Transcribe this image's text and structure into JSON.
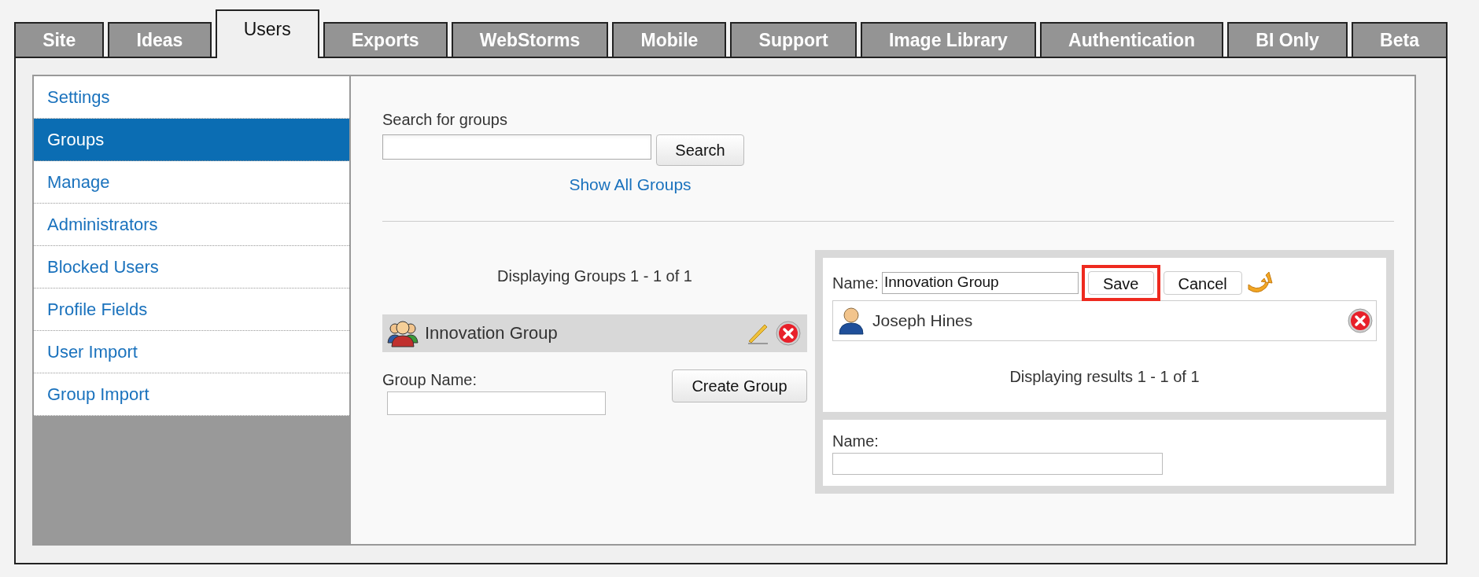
{
  "tabs": [
    {
      "label": "Site",
      "selected": false
    },
    {
      "label": "Ideas",
      "selected": false
    },
    {
      "label": "Users",
      "selected": true
    },
    {
      "label": "Exports",
      "selected": false
    },
    {
      "label": "WebStorms",
      "selected": false
    },
    {
      "label": "Mobile",
      "selected": false
    },
    {
      "label": "Support",
      "selected": false
    },
    {
      "label": "Image Library",
      "selected": false
    },
    {
      "label": "Authentication",
      "selected": false
    },
    {
      "label": "BI Only",
      "selected": false
    },
    {
      "label": "Beta",
      "selected": false
    }
  ],
  "sidebar": {
    "items": [
      {
        "label": "Settings",
        "selected": false
      },
      {
        "label": "Groups",
        "selected": true
      },
      {
        "label": "Manage",
        "selected": false
      },
      {
        "label": "Administrators",
        "selected": false
      },
      {
        "label": "Blocked Users",
        "selected": false
      },
      {
        "label": "Profile Fields",
        "selected": false
      },
      {
        "label": "User Import",
        "selected": false
      },
      {
        "label": "Group Import",
        "selected": false
      }
    ]
  },
  "search": {
    "label": "Search for groups",
    "button": "Search",
    "link": "Show All Groups"
  },
  "groups_list": {
    "summary": "Displaying Groups 1 - 1 of 1",
    "rows": [
      {
        "name": "Innovation Group"
      }
    ]
  },
  "create_group": {
    "label": "Group Name:",
    "button": "Create Group"
  },
  "edit_group": {
    "label": "Name:",
    "value": "Innovation Group",
    "buttons": [
      {
        "label": "Save",
        "highlighted": true
      },
      {
        "label": "Cancel",
        "highlighted": false
      }
    ],
    "members": [
      {
        "name": "Joseph Hines"
      }
    ],
    "summary": "Displaying results 1 - 1 of 1"
  },
  "add_member": {
    "label": "Name:"
  }
}
